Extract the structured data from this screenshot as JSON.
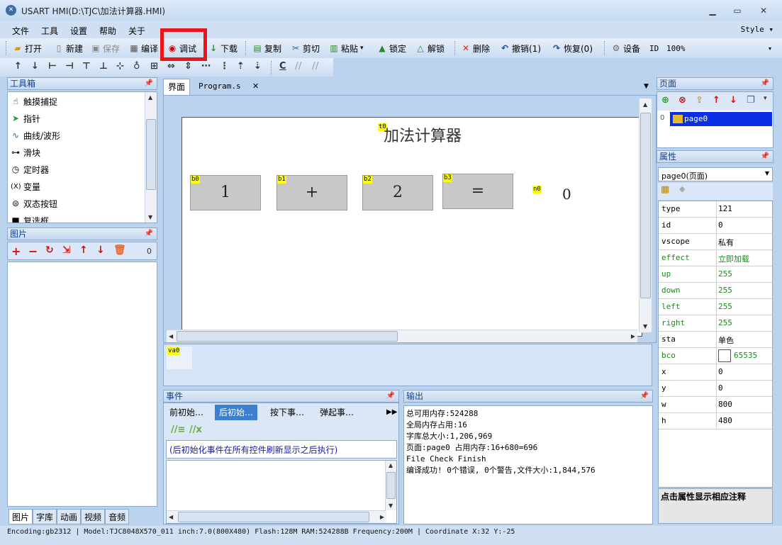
{
  "window": {
    "title": "USART HMI(D:\\TJC\\加法计算器.HMI)"
  },
  "menu": {
    "items": [
      "文件",
      "工具",
      "设置",
      "帮助",
      "关于"
    ],
    "style_label": "Style"
  },
  "toolbar": {
    "open": "打开",
    "new": "新建",
    "save": "保存",
    "compile": "编译",
    "debug": "调试",
    "download": "下载",
    "copy": "复制",
    "cut": "剪切",
    "paste": "粘贴",
    "lock": "锁定",
    "unlock": "解锁",
    "delete": "删除",
    "undo": "撤销(1)",
    "redo": "恢复(0)",
    "device": "设备",
    "id": "ID",
    "zoom": "100%"
  },
  "toolbox": {
    "title": "工具箱",
    "items": [
      "触摸捕捉",
      "指针",
      "曲线/波形",
      "滑块",
      "定时器",
      "变量",
      "双态按钮",
      "复选框"
    ]
  },
  "pictures": {
    "title": "图片",
    "count": "0"
  },
  "doc": {
    "tabs": [
      "界面",
      "Program.s"
    ]
  },
  "canvas": {
    "title_obj": "t0",
    "title_text": "加法计算器",
    "buttons": [
      {
        "name": "b0",
        "text": "1"
      },
      {
        "name": "b1",
        "text": "+"
      },
      {
        "name": "b2",
        "text": "2"
      },
      {
        "name": "b3",
        "text": "="
      }
    ],
    "number": {
      "name": "n0",
      "value": "0"
    },
    "var": "va0"
  },
  "events": {
    "title": "事件",
    "tabs": [
      "前初始…",
      "后初始…",
      "按下事…",
      "弹起事…"
    ],
    "description": "(后初始化事件在所有控件刷新显示之后执行)"
  },
  "output": {
    "title": "输出",
    "lines": [
      "总可用内存:524288",
      "全局内存占用:16",
      "字库总大小:1,206,969",
      "页面:page0 占用内存:16+680=696",
      "File Check Finish",
      "编译成功! 0个错误, 0个警告,文件大小:1,844,576"
    ]
  },
  "pages": {
    "title": "页面",
    "items": [
      {
        "index": "0",
        "name": "page0"
      }
    ]
  },
  "properties": {
    "title": "属性",
    "selected": "page0(页面)",
    "rows": [
      {
        "key": "type",
        "value": "121"
      },
      {
        "key": "id",
        "value": "0"
      },
      {
        "key": "vscope",
        "value": "私有"
      },
      {
        "key": "effect",
        "value": "立即加载"
      },
      {
        "key": "up",
        "value": "255"
      },
      {
        "key": "down",
        "value": "255"
      },
      {
        "key": "left",
        "value": "255"
      },
      {
        "key": "right",
        "value": "255"
      },
      {
        "key": "sta",
        "value": "单色"
      },
      {
        "key": "bco",
        "value": "65535"
      },
      {
        "key": "x",
        "value": "0"
      },
      {
        "key": "y",
        "value": "0"
      },
      {
        "key": "w",
        "value": "800"
      },
      {
        "key": "h",
        "value": "480"
      }
    ],
    "hint": "点击属性显示相应注释"
  },
  "bottom_tabs": [
    "图片",
    "字库",
    "动画",
    "视频",
    "音频"
  ],
  "status": "Encoding:gb2312  | Model:TJC8048X570_011  inch:7.0(800X480) Flash:128M RAM:524288B Frequency:200M   |   Coordinate X:32  Y:-25"
}
